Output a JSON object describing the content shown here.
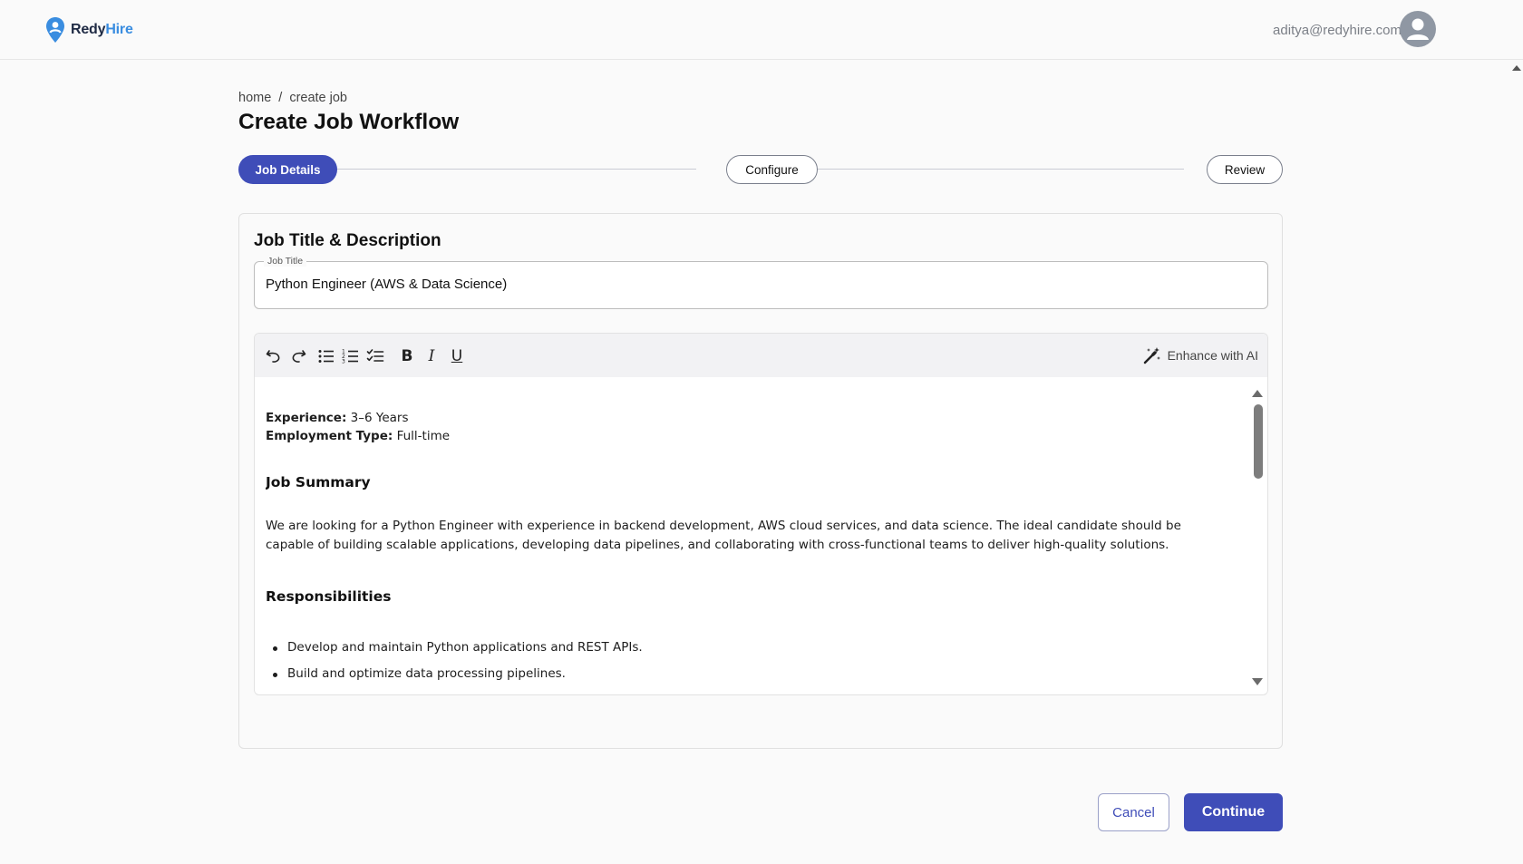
{
  "header": {
    "brand_part1": "Redy",
    "brand_part2": "Hire",
    "user_email": "aditya@redyhire.com"
  },
  "breadcrumb": {
    "home": "home",
    "separator": "/",
    "current": "create job"
  },
  "page_title": "Create Job Workflow",
  "steps": [
    {
      "label": "Job Details",
      "state": "active"
    },
    {
      "label": "Configure",
      "state": "inactive"
    },
    {
      "label": "Review",
      "state": "inactive"
    }
  ],
  "card": {
    "title": "Job Title & Description",
    "job_title_label": "Job Title",
    "job_title_value": "Python Engineer (AWS & Data Science)"
  },
  "toolbar": {
    "icons": [
      "undo-icon",
      "redo-icon",
      "bullet-list-icon",
      "numbered-list-icon",
      "checklist-icon",
      "bold-icon",
      "italic-icon",
      "underline-icon"
    ],
    "bold": "B",
    "italic": "I",
    "underline": "U",
    "enhance_label": "Enhance with AI"
  },
  "editor": {
    "experience_label": "Experience:",
    "experience_value": "3–6 Years",
    "employment_label": "Employment Type:",
    "employment_value": "Full-time",
    "summary_heading": "Job Summary",
    "summary_text": "We are looking for a Python Engineer with experience in backend development, AWS cloud services, and data science. The ideal candidate should be capable of building scalable applications, developing data pipelines, and collaborating with cross-functional teams to deliver high-quality solutions.",
    "responsibilities_heading": "Responsibilities",
    "responsibilities": [
      "Develop and maintain Python applications and REST APIs.",
      "Build and optimize data processing pipelines."
    ]
  },
  "actions": {
    "cancel": "Cancel",
    "continue": "Continue"
  },
  "colors": {
    "primary": "#3f4db8",
    "brand_blue": "#3a8de0"
  }
}
